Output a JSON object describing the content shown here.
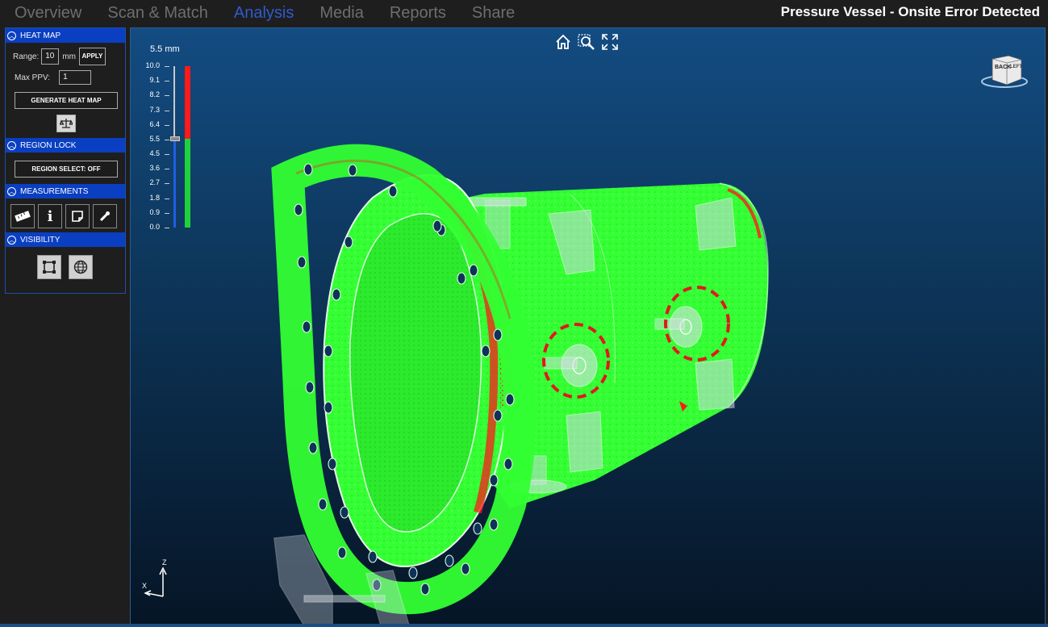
{
  "nav": {
    "tabs": [
      {
        "label": "Overview",
        "active": false
      },
      {
        "label": "Scan & Match",
        "active": false
      },
      {
        "label": "Analysis",
        "active": true
      },
      {
        "label": "Media",
        "active": false
      },
      {
        "label": "Reports",
        "active": false
      },
      {
        "label": "Share",
        "active": false
      }
    ]
  },
  "window": {
    "title": "Pressure Vessel - Onsite Error Detected"
  },
  "sidebar": {
    "heat_map": {
      "title": "HEAT MAP",
      "range_label": "Range:",
      "range_value": "10",
      "range_unit": "mm",
      "apply_label": "APPLY",
      "max_ppv_label": "Max PPV:",
      "max_ppv_value": "1",
      "generate_label": "GENERATE HEAT MAP",
      "icon": "balance-scale-icon"
    },
    "region_lock": {
      "title": "REGION LOCK",
      "region_select_label": "REGION SELECT: OFF"
    },
    "measurements": {
      "title": "MEASUREMENTS",
      "tools": [
        "ruler-icon",
        "info-icon",
        "note-icon",
        "probe-icon"
      ]
    },
    "visibility": {
      "title": "VISIBILITY",
      "tools": [
        "bounding-box-icon",
        "globe-icon"
      ]
    }
  },
  "viewport": {
    "toolbar": [
      "home-icon",
      "zoom-region-icon",
      "fit-extents-icon"
    ],
    "view_cube": {
      "faces": [
        "BACK",
        "LEFT"
      ]
    },
    "scale": {
      "current_value": "5.5 mm",
      "current_fraction": 0.55,
      "ticks": [
        "10.0",
        "9.1",
        "8.2",
        "7.3",
        "6.4",
        "5.5",
        "4.5",
        "3.6",
        "2.7",
        "1.8",
        "0.9",
        "0.0"
      ],
      "colors": {
        "above": "#ff1a1a",
        "below": "#1fd13a",
        "slider": "#1f5fe0"
      }
    },
    "axis_triad": {
      "z": "Z",
      "x": "X"
    },
    "colors": {
      "deviation_high": "#ff1a1a",
      "within_tolerance": "#33ff33",
      "highlight": "#e0181e"
    }
  }
}
